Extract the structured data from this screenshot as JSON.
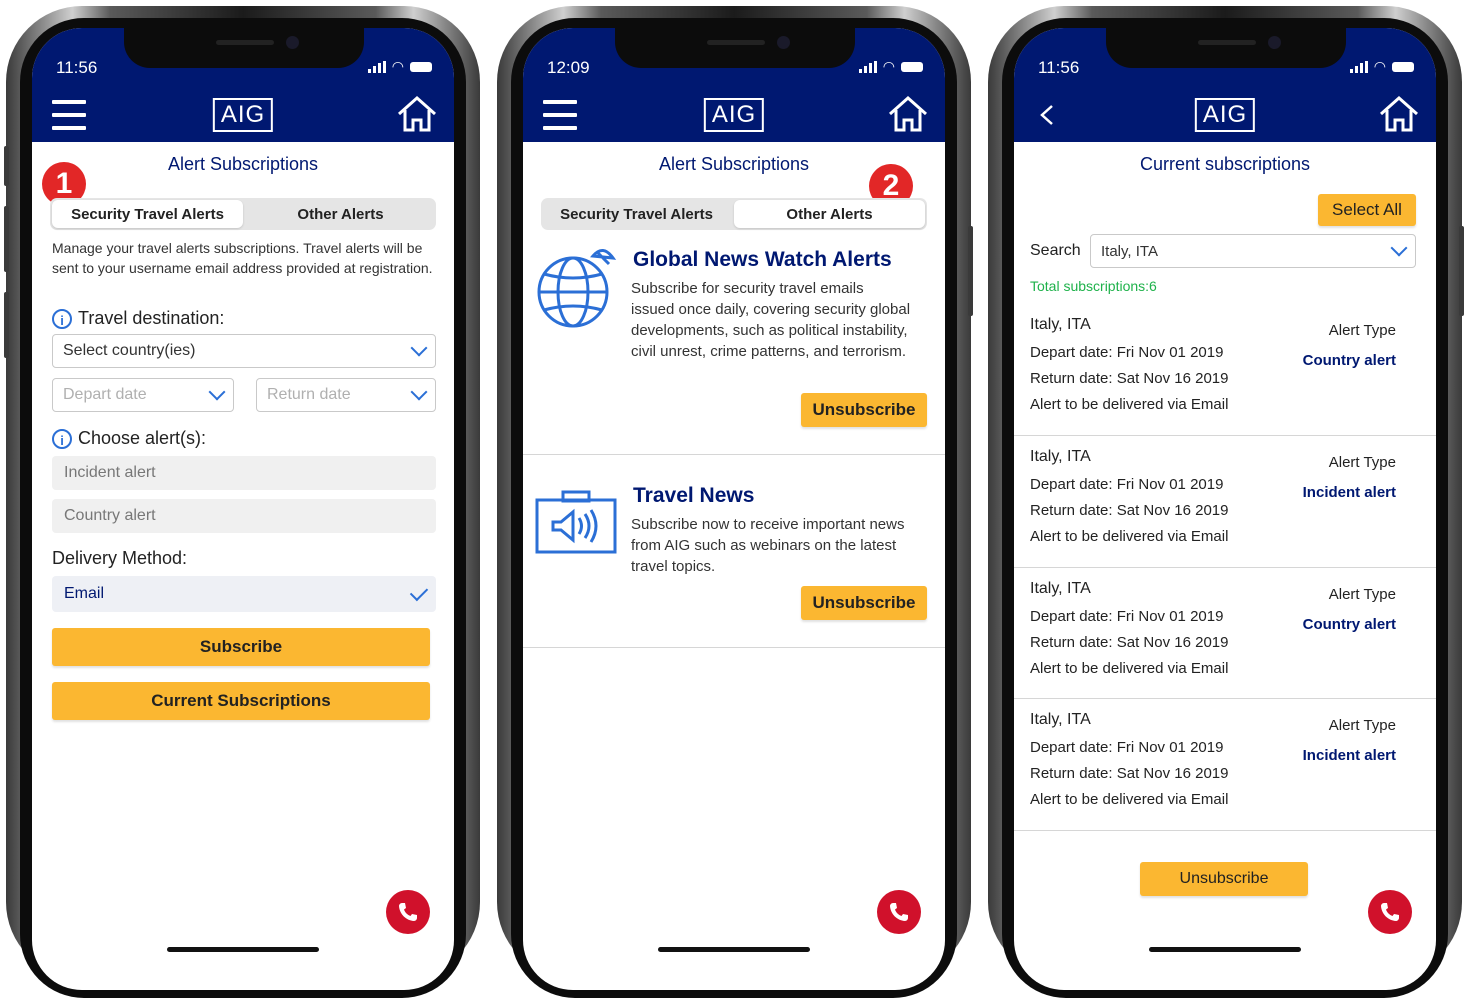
{
  "status": {
    "time_left": "11:56",
    "time_mid": "12:09",
    "time_right": "11:56"
  },
  "logo": "AIG",
  "screen1": {
    "badge": "1",
    "title": "Alert Subscriptions",
    "tab_security": "Security Travel Alerts",
    "tab_other": "Other Alerts",
    "description": "Manage your travel alerts subscriptions. Travel alerts will be sent to your username email address provided at registration.",
    "travel_destination_label": "Travel destination:",
    "country_placeholder": "Select country(ies)",
    "depart_placeholder": "Depart date",
    "return_placeholder": "Return date",
    "choose_alerts_label": "Choose alert(s):",
    "alert_options": [
      "Incident alert",
      "Country alert"
    ],
    "delivery_label": "Delivery Method:",
    "delivery_value": "Email",
    "subscribe_button": "Subscribe",
    "current_subscriptions_button": "Current Subscriptions"
  },
  "screen2": {
    "badge": "2",
    "title": "Alert Subscriptions",
    "tab_security": "Security Travel Alerts",
    "tab_other": "Other Alerts",
    "cards": [
      {
        "title": "Global News Watch Alerts",
        "text": "Subscribe for security travel emails issued once daily, covering security global developments, such as political instability, civil unrest, crime patterns, and terrorism.",
        "button": "Unsubscribe"
      },
      {
        "title": "Travel News",
        "text": "Subscribe now to receive important news from AIG such as webinars on the latest travel topics.",
        "button": "Unsubscribe"
      }
    ]
  },
  "screen3": {
    "title": "Current subscriptions",
    "select_all_button": "Select All",
    "search_label": "Search",
    "search_value": "Italy, ITA",
    "total": "Total subscriptions:6",
    "alert_type_label": "Alert Type",
    "items": [
      {
        "city": "Italy, ITA",
        "depart": "Depart date: Fri Nov 01 2019",
        "return": "Return date: Sat Nov 16 2019",
        "delivery": "Alert to be delivered via Email",
        "type": "Country alert"
      },
      {
        "city": "Italy, ITA",
        "depart": "Depart date: Fri Nov 01 2019",
        "return": "Return date: Sat Nov 16 2019",
        "delivery": "Alert to be delivered via Email",
        "type": "Incident alert"
      },
      {
        "city": "Italy, ITA",
        "depart": "Depart date: Fri Nov 01 2019",
        "return": "Return date: Sat Nov 16 2019",
        "delivery": "Alert to be delivered via Email",
        "type": "Country alert"
      },
      {
        "city": "Italy, ITA",
        "depart": "Depart date: Fri Nov 01 2019",
        "return": "Return date: Sat Nov 16 2019",
        "delivery": "Alert to be delivered via Email",
        "type": "Incident alert"
      }
    ],
    "unsubscribe_button": "Unsubscribe"
  },
  "colors": {
    "header": "#001871",
    "accent": "#fbb731",
    "badge": "#e22727",
    "call": "#d0112b",
    "link": "#2b6fd6",
    "total": "#1fb24b"
  },
  "icons": [
    "menu-icon",
    "home-icon",
    "back-icon",
    "info-icon",
    "chevron-down-icon",
    "check-icon",
    "globe-icon",
    "megaphone-icon",
    "phone-icon"
  ]
}
